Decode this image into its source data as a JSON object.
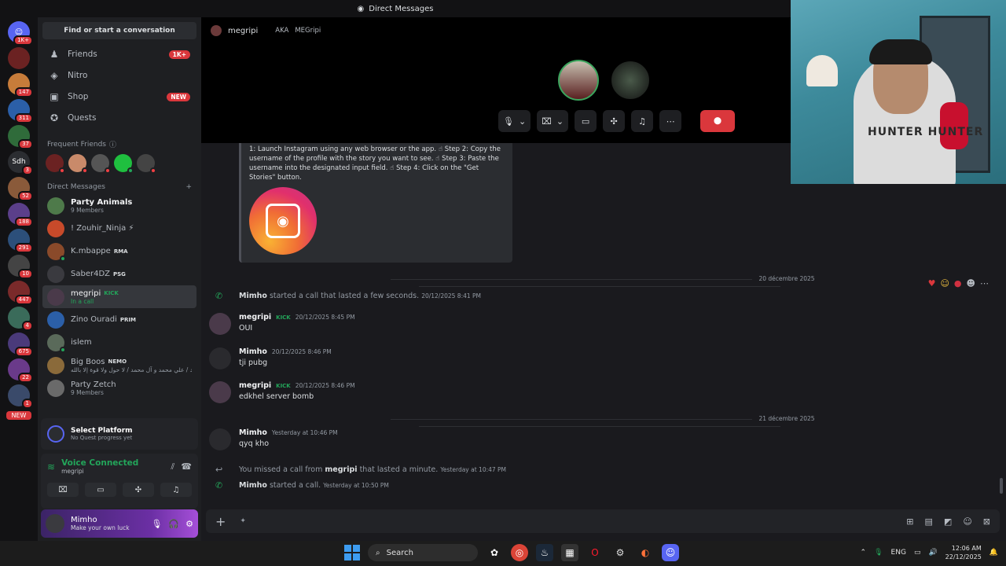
{
  "titlebar": {
    "title": "Direct Messages"
  },
  "guild_rail": {
    "badges": [
      "1K+",
      "",
      "147",
      "311",
      "37",
      "3",
      "52",
      "188",
      "291",
      "10",
      "447",
      "4",
      "675",
      "22",
      "1"
    ],
    "sdh_label": "Sdh",
    "new_label": "NEW"
  },
  "sidebar": {
    "search_label": "Find or start a conversation",
    "nav": [
      {
        "label": "Friends",
        "badge": "1K+",
        "icon": "friends-icon"
      },
      {
        "label": "Nitro",
        "badge": "",
        "icon": "nitro-icon"
      },
      {
        "label": "Shop",
        "badge": "NEW",
        "icon": "shop-icon"
      },
      {
        "label": "Quests",
        "badge": "",
        "icon": "quests-icon"
      }
    ],
    "frequent_label": "Frequent Friends",
    "dm_label": "Direct Messages",
    "dms": [
      {
        "name": "Party Animals",
        "sub": "9 Members",
        "tag": ""
      },
      {
        "name": "! Zouhir_Ninja ⚡",
        "sub": "",
        "tag": ""
      },
      {
        "name": "K.mbappe",
        "sub": "",
        "tag": "RMA"
      },
      {
        "name": "Saber4DZ",
        "sub": "",
        "tag": "PSG"
      },
      {
        "name": "megripi",
        "sub": "In a call",
        "tag": "KICK"
      },
      {
        "name": "Zino Ouradi",
        "sub": "",
        "tag": "PRIM"
      },
      {
        "name": "islem",
        "sub": "",
        "tag": ""
      },
      {
        "name": "Big Boos",
        "sub": "يا رسول الله محمد / علي محمد و آل محمد / لا حول ولا قوة إلا بالله",
        "tag": "NEMO"
      },
      {
        "name": "Party Zetch",
        "sub": "9 Members",
        "tag": ""
      }
    ],
    "quest": {
      "title": "Select Platform",
      "sub": "No Quest progress yet"
    },
    "voice": {
      "title": "Voice Connected",
      "sub": "megripi"
    },
    "user": {
      "name": "Mimho",
      "status": "Make your own luck"
    }
  },
  "call": {
    "user": "megripi",
    "aka_label": "AKA",
    "aka_value": "MEGripi",
    "end_label": "⬤"
  },
  "embed": {
    "text": "1: Launch Instagram using any web browser or the app. ☝ Step 2: Copy the username of the profile with the story you want to see. ☝ Step 3: Paste the username into the designated input field. ☝ Step 4: Click on the \"Get Stories\" button."
  },
  "messages": {
    "date1": "20 décembre 2025",
    "date2": "21 décembre 2025",
    "sys1": {
      "author": "Mimho",
      "text": "started a call that lasted a few seconds.",
      "time": "20/12/2025 8:41 PM"
    },
    "m1": {
      "author": "megripi",
      "badge": "KICK",
      "time": "20/12/2025 8:45 PM",
      "body": "OUI"
    },
    "m2": {
      "author": "Mimho",
      "badge": "",
      "time": "20/12/2025 8:46 PM",
      "body": "tji pubg"
    },
    "m3": {
      "author": "megripi",
      "badge": "KICK",
      "time": "20/12/2025 8:46 PM",
      "body": "edkhel server bomb"
    },
    "m4": {
      "author": "Mimho",
      "badge": "",
      "time": "Yesterday at 10:46 PM",
      "body": "qyq kho"
    },
    "sys2": {
      "pre": "You missed a call from",
      "author": "megripi",
      "text": "that lasted a minute.",
      "time": "Yesterday at 10:47 PM"
    },
    "sys3": {
      "author": "Mimho",
      "text": "started a call.",
      "time": "Yesterday at 10:50 PM"
    }
  },
  "composer": {
    "placeholder": ""
  },
  "taskbar": {
    "search_label": "Search",
    "lang": "ENG",
    "time": "12:06 AM",
    "date": "22/12/2025"
  },
  "webcam": {
    "shirt_text": "HUNTER HUNTER"
  },
  "colors": {
    "accent": "#5865f2",
    "online": "#23a55a",
    "danger": "#da373c"
  }
}
